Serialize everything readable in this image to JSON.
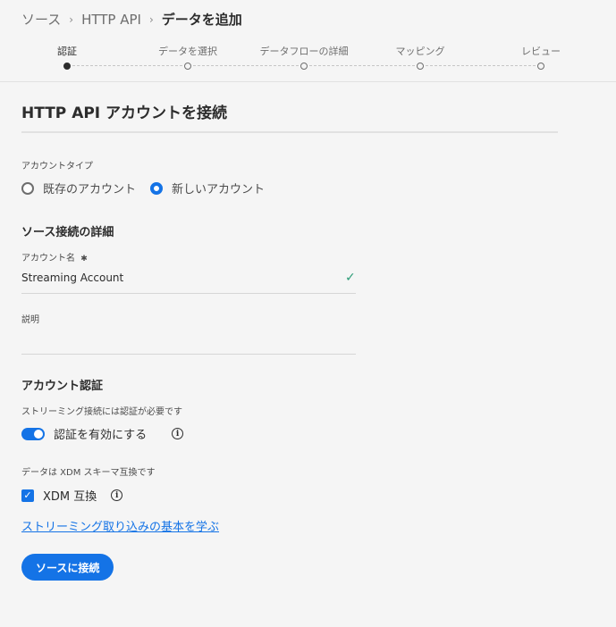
{
  "breadcrumb": {
    "items": [
      "ソース",
      "HTTP API"
    ],
    "current": "データを追加",
    "separator": "›"
  },
  "stepper": {
    "steps": [
      {
        "label": "認証",
        "active": true
      },
      {
        "label": "データを選択",
        "active": false
      },
      {
        "label": "データフローの詳細",
        "active": false
      },
      {
        "label": "マッピング",
        "active": false
      },
      {
        "label": "レビュー",
        "active": false
      }
    ]
  },
  "page": {
    "title": "HTTP API アカウントを接続"
  },
  "account_type": {
    "label": "アカウントタイプ",
    "options": [
      {
        "label": "既存のアカウント",
        "selected": false
      },
      {
        "label": "新しいアカウント",
        "selected": true
      }
    ]
  },
  "source_details": {
    "heading": "ソース接続の詳細",
    "account_name_label": "アカウント名",
    "required_marker": "✱",
    "account_name_value": "Streaming Account",
    "valid_icon": "checkmark-icon",
    "description_label": "説明",
    "description_value": ""
  },
  "auth": {
    "heading": "アカウント認証",
    "hint": "ストリーミング接続には認証が必要です",
    "toggle_label": "認証を有効にする",
    "toggle_on": true,
    "info_glyph": "i"
  },
  "xdm": {
    "hint": "データは XDM スキーマ互換です",
    "checkbox_label": "XDM 互換",
    "checked": true,
    "check_glyph": "✓",
    "info_glyph": "i"
  },
  "links": {
    "learn": "ストリーミング取り込みの基本を学ぶ"
  },
  "actions": {
    "connect_label": "ソースに接続"
  },
  "colors": {
    "accent": "#1473e6",
    "valid": "#2d9d78",
    "background": "#f5f5f5"
  }
}
